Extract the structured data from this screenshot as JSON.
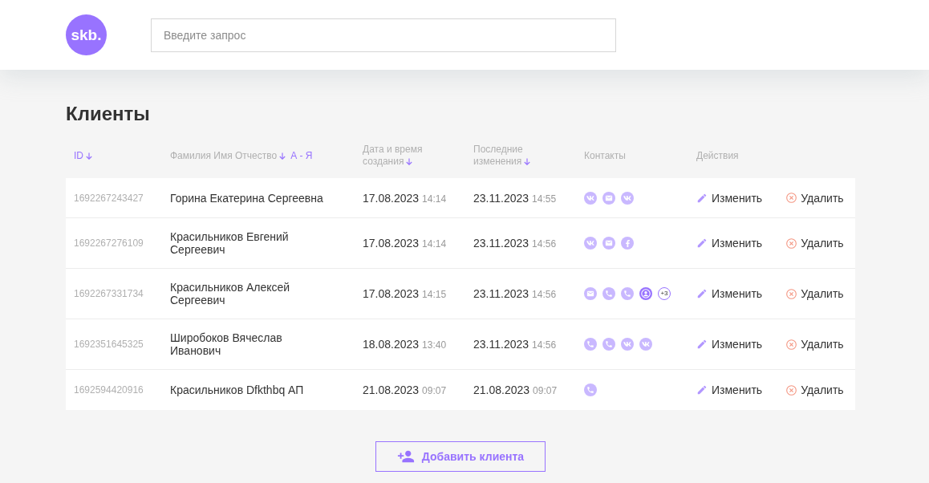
{
  "header": {
    "logo": "skb.",
    "search": {
      "placeholder": "Введите запрос"
    }
  },
  "title": "Клиенты",
  "table": {
    "columns": [
      {
        "label": "ID",
        "sortable": true,
        "selected": true
      },
      {
        "label": "Фамилия Имя Отчество",
        "sortable": true,
        "selected": false,
        "sort_hint": "А - Я"
      },
      {
        "label": "Дата и время создания",
        "sortable": true,
        "selected": false
      },
      {
        "label": "Последние изменения",
        "sortable": true,
        "selected": false
      },
      {
        "label": "Контакты",
        "sortable": false,
        "selected": false
      },
      {
        "label": "Действия",
        "sortable": false,
        "selected": false
      }
    ],
    "rows": [
      {
        "id": "1692267243427",
        "name": "Горина Екатерина Сергеевна",
        "created": {
          "date": "17.08.2023",
          "time": "14:14"
        },
        "updated": {
          "date": "23.11.2023",
          "time": "14:55"
        },
        "contacts": [
          {
            "kind": "vk",
            "highlighted": false
          },
          {
            "kind": "mail",
            "highlighted": false
          },
          {
            "kind": "vk",
            "highlighted": false
          }
        ],
        "actions": [
          {
            "kind": "edit",
            "label": "Изменить"
          },
          {
            "kind": "delete",
            "label": "Удалить"
          }
        ]
      },
      {
        "id": "1692267276109",
        "name": "Красильников Евгений Сергеевич",
        "created": {
          "date": "17.08.2023",
          "time": "14:14"
        },
        "updated": {
          "date": "23.11.2023",
          "time": "14:56"
        },
        "contacts": [
          {
            "kind": "vk",
            "highlighted": false
          },
          {
            "kind": "mail",
            "highlighted": false
          },
          {
            "kind": "facebook",
            "highlighted": false
          }
        ],
        "actions": [
          {
            "kind": "edit",
            "label": "Изменить"
          },
          {
            "kind": "delete",
            "label": "Удалить"
          }
        ]
      },
      {
        "id": "1692267331734",
        "name": "Красильников Алексей Сергеевич",
        "created": {
          "date": "17.08.2023",
          "time": "14:15"
        },
        "updated": {
          "date": "23.11.2023",
          "time": "14:56"
        },
        "contacts": [
          {
            "kind": "mail",
            "highlighted": false
          },
          {
            "kind": "phone",
            "highlighted": false
          },
          {
            "kind": "phone",
            "highlighted": false
          },
          {
            "kind": "user",
            "highlighted": true
          }
        ],
        "more_contacts": "+3",
        "actions": [
          {
            "kind": "edit",
            "label": "Изменить"
          },
          {
            "kind": "delete",
            "label": "Удалить"
          }
        ]
      },
      {
        "id": "1692351645325",
        "name": "Широбоков Вячеслав Иванович",
        "created": {
          "date": "18.08.2023",
          "time": "13:40"
        },
        "updated": {
          "date": "23.11.2023",
          "time": "14:56"
        },
        "contacts": [
          {
            "kind": "phone",
            "highlighted": false
          },
          {
            "kind": "phone",
            "highlighted": false
          },
          {
            "kind": "vk",
            "highlighted": false
          },
          {
            "kind": "vk",
            "highlighted": false
          }
        ],
        "actions": [
          {
            "kind": "edit",
            "label": "Изменить"
          },
          {
            "kind": "delete",
            "label": "Удалить"
          }
        ]
      },
      {
        "id": "1692594420916",
        "name": "Красильников Dfkthbq АП",
        "created": {
          "date": "21.08.2023",
          "time": "09:07"
        },
        "updated": {
          "date": "21.08.2023",
          "time": "09:07"
        },
        "contacts": [
          {
            "kind": "phone",
            "highlighted": false
          }
        ],
        "actions": [
          {
            "kind": "edit",
            "label": "Изменить"
          },
          {
            "kind": "delete",
            "label": "Удалить"
          }
        ]
      }
    ]
  },
  "add_button": {
    "label": "Добавить клиента"
  }
}
